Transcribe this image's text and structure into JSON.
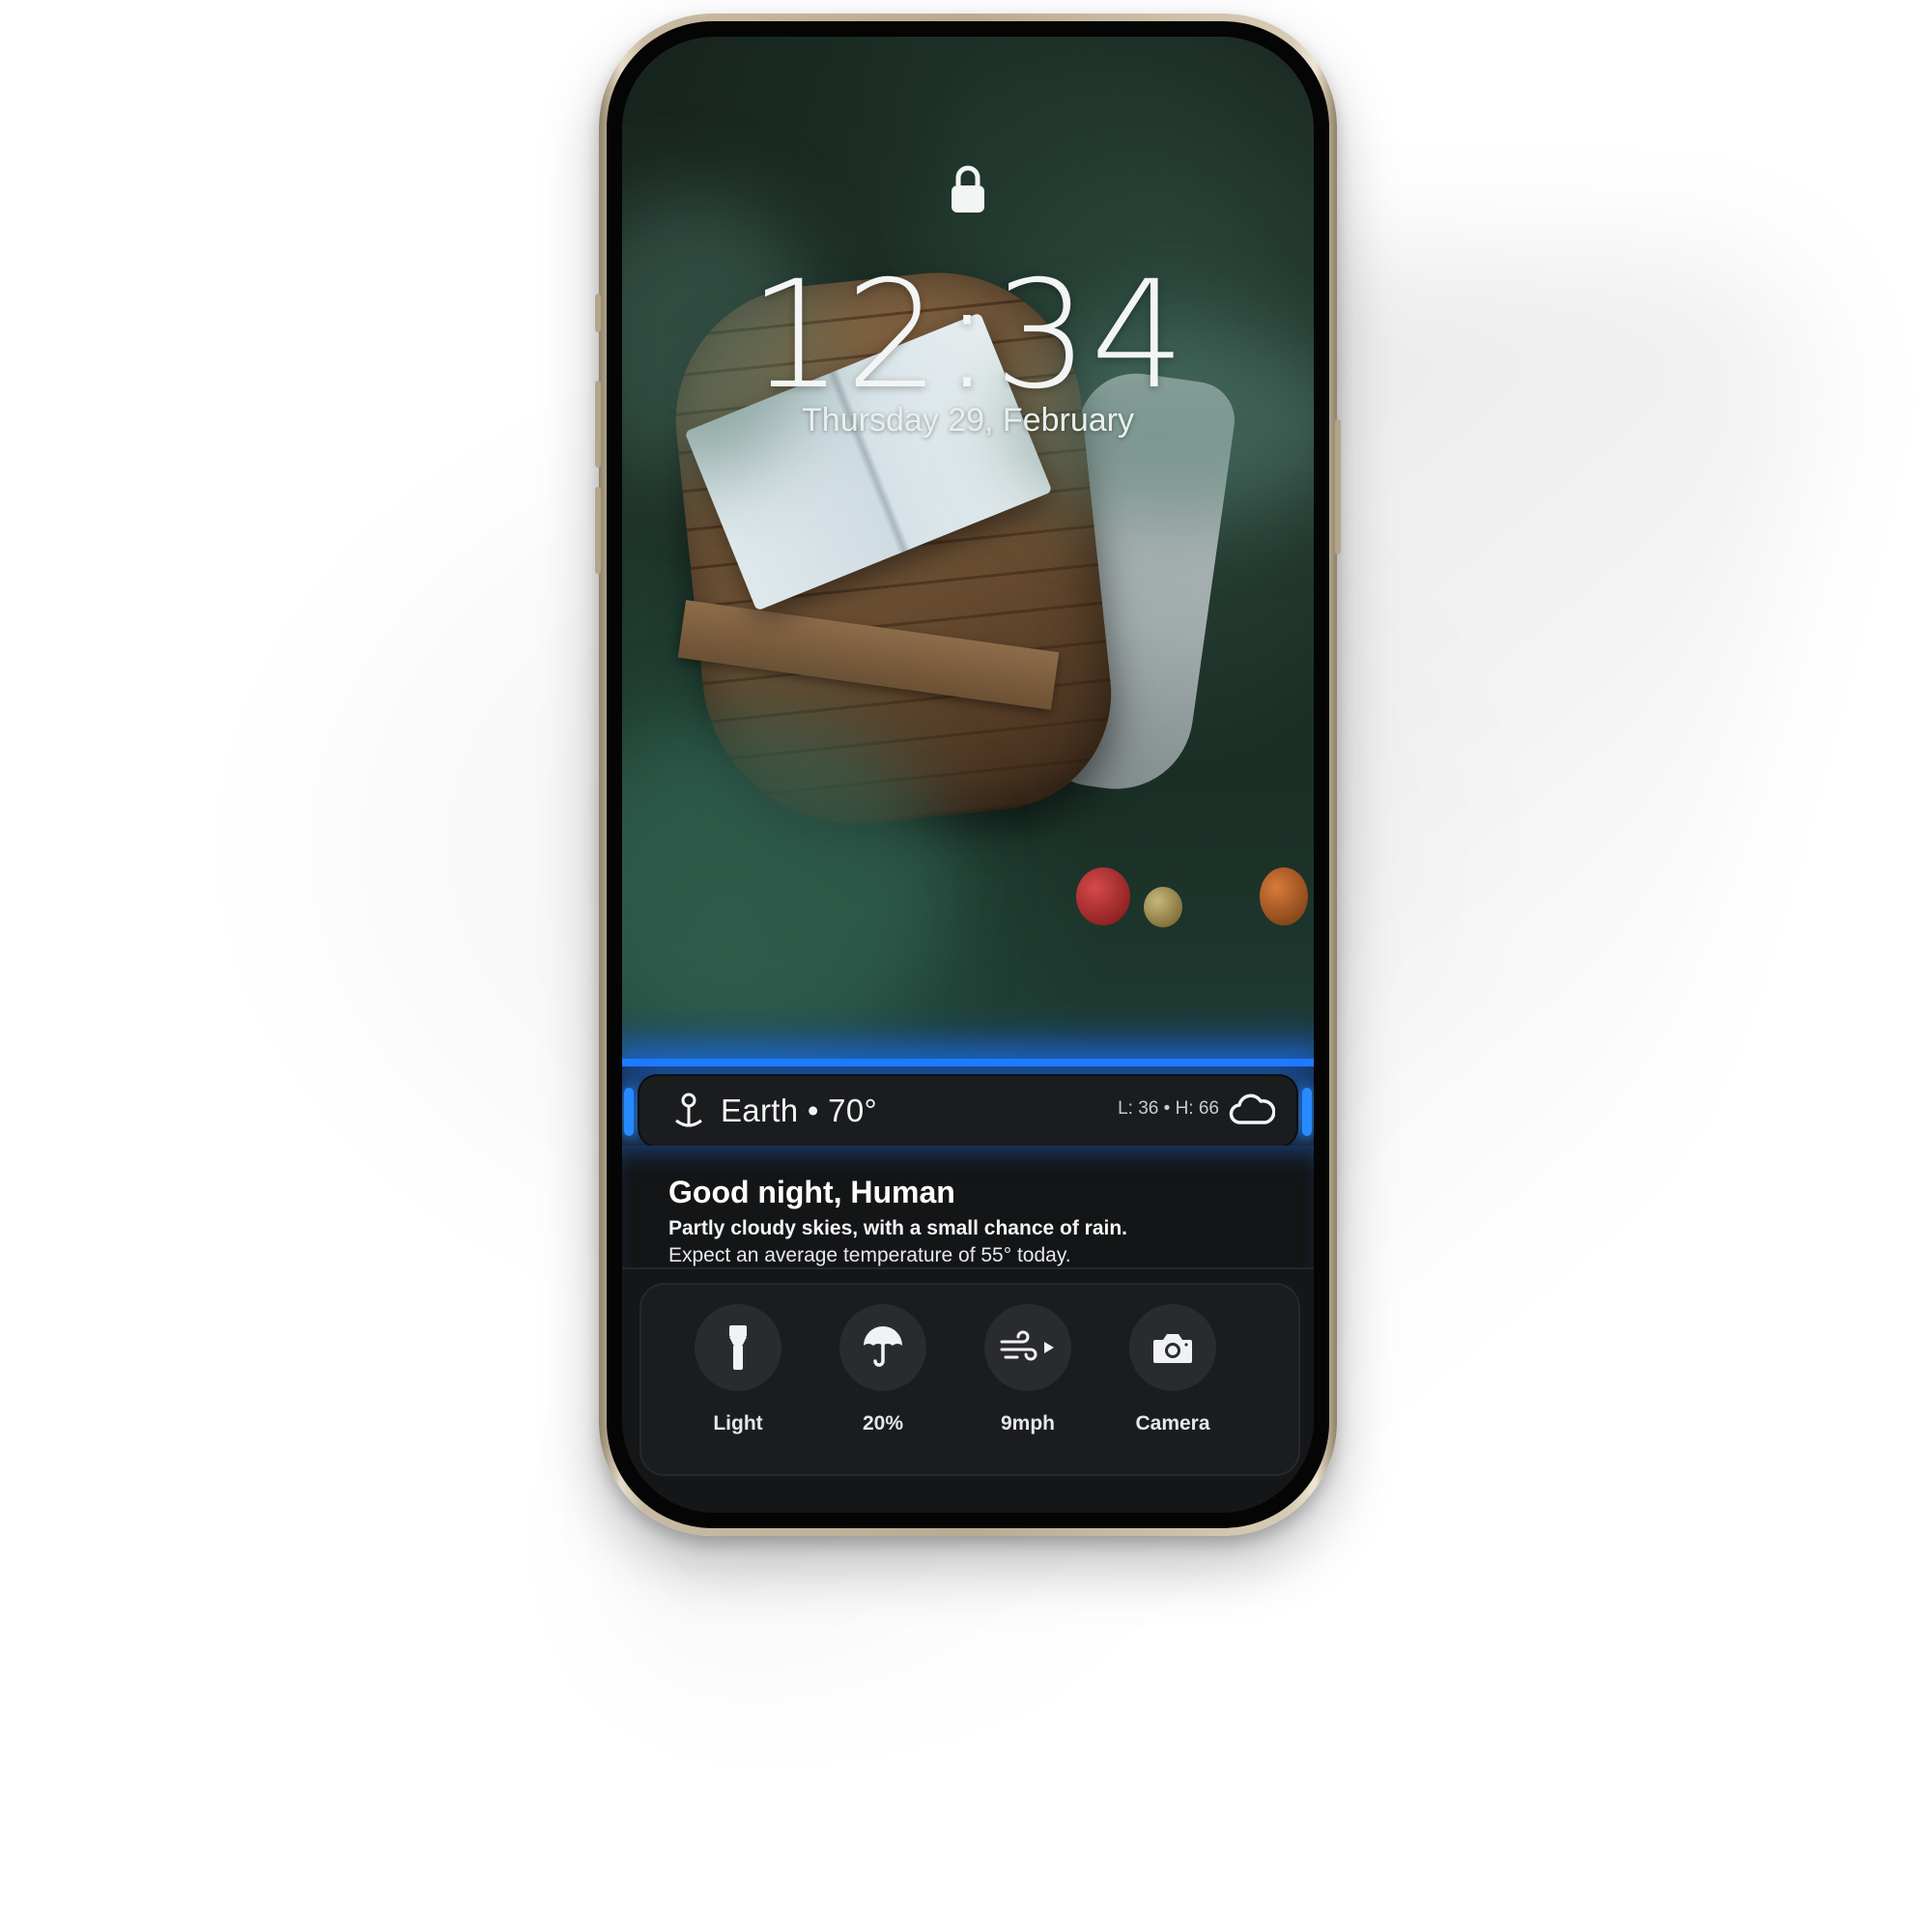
{
  "lockscreen": {
    "time": "12:34",
    "date": "Thursday 29, February"
  },
  "weather": {
    "location_temp": "Earth • 70°",
    "low_high": "L: 36 • H: 66",
    "icons": [
      "location-pin-icon",
      "cloud-icon"
    ]
  },
  "greeting": {
    "title": "Good night, Human",
    "summary": "Partly cloudy skies, with a small chance of rain.",
    "detail": "Expect an average temperature of 55° today."
  },
  "controls": [
    {
      "label": "Light",
      "icon": "flashlight-icon"
    },
    {
      "label": "20%",
      "icon": "umbrella-icon"
    },
    {
      "label": "9mph",
      "icon": "wind-icon"
    },
    {
      "label": "Camera",
      "icon": "camera-icon"
    }
  ],
  "colors": {
    "accent_glow": "#1f7bff",
    "panel_bg": "#1b1c1e",
    "frame": "#c9bba3"
  }
}
